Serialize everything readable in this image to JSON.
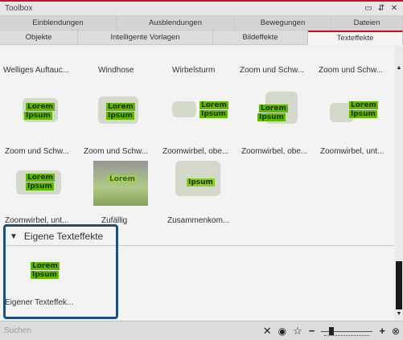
{
  "window": {
    "title": "Toolbox",
    "controls": [
      "▭",
      "⇵",
      "✕"
    ]
  },
  "tabs_row1": [
    "Einblendungen",
    "Ausblendungen",
    "Bewegungen",
    "Dateien"
  ],
  "tabs_row2": [
    "Objekte",
    "Intelligente Vorlagen",
    "Bildeffekte",
    "Texteffekte"
  ],
  "active_tab": "Texteffekte",
  "top_row_labels": [
    "Welliges Auftauc...",
    "Windhose",
    "Wirbelsturm",
    "Zoom und Schw...",
    "Zoom und Schw..."
  ],
  "items_row2": [
    "Zoom und Schw...",
    "Zoom und Schw...",
    "Zoomwirbel, obe...",
    "Zoomwirbel, obe...",
    "Zoomwirbel, unt..."
  ],
  "items_row3": [
    "Zoomwirbel, unt...",
    "Zufällig",
    "Zusammenkom..."
  ],
  "preview_text": {
    "line1": "Lorem",
    "line2": "Ipsum"
  },
  "section": {
    "title": "Eigene Texteffekte",
    "arrow": "▼",
    "item_label": "Eigener Texteffek..."
  },
  "statusbar": {
    "search_placeholder": "Suchen"
  },
  "colors": {
    "accent": "#c8102e",
    "highlight_border": "#1d4f78",
    "lorem_bg": "#62b800"
  }
}
